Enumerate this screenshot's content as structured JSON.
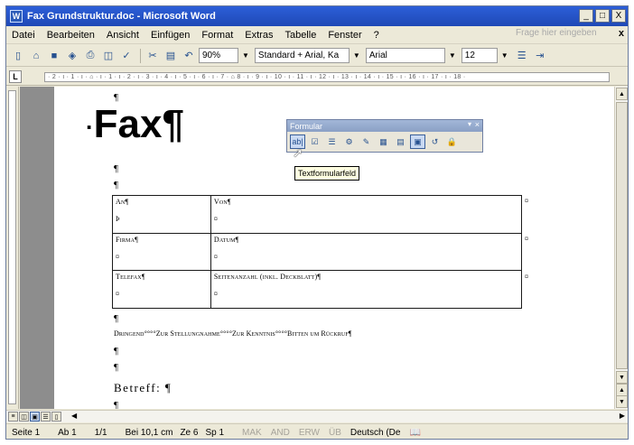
{
  "window": {
    "title": "Fax Grundstruktur.doc - Microsoft Word",
    "buttons": [
      "_",
      "□",
      "X"
    ],
    "app_icon": "W"
  },
  "menu": {
    "items": [
      "Datei",
      "Bearbeiten",
      "Ansicht",
      "Einfügen",
      "Format",
      "Extras",
      "Tabelle",
      "Fenster",
      "?"
    ],
    "help_placeholder": "Frage hier eingeben",
    "close_doc": "x"
  },
  "toolbar": {
    "zoom": "90%",
    "style": "Standard + Arial, Ka",
    "font": "Arial",
    "size": "12",
    "icons": [
      "new-doc-icon",
      "open-icon",
      "save-icon",
      "permission-icon",
      "print-icon",
      "preview-icon",
      "spelling-icon",
      "cut-icon",
      "paste-icon",
      "undo-icon"
    ]
  },
  "ruler": {
    "text": "· 2 · ı · 1 · ı · ⌂ · ı · 1 · ı · 2 · ı · 3 · ı · 4 · ı · 5 · ı · 6 · ı · 7 · ⌂ 8 · ı · 9 · ı · 10 · ı · 11 · ı · 12 · ı · 13 · ı · 14 · ı · 15 · ı · 16 · ı · 17 · ı · 18 ·"
  },
  "document": {
    "pilcrow": "¶",
    "title": "Fax¶",
    "title_bullet": "·",
    "table": {
      "rows": [
        [
          {
            "label": "An¶",
            "value": "Þ"
          },
          {
            "label": "Von¶",
            "value": "¤"
          }
        ],
        [
          {
            "label": "Firma¶",
            "value": "¤"
          },
          {
            "label": "Datum¶",
            "value": "¤"
          }
        ],
        [
          {
            "label": "Telefax¶",
            "value": "¤"
          },
          {
            "label": "Seitenanzahl (inkl. Deckblatt)¶",
            "value": "¤"
          }
        ]
      ],
      "row_end_mark": "¤"
    },
    "urgency_line": "Dringend°°°°Zur Stellungnahme°°°°Zur Kenntnis°°°°Bitten um Rückruf¶",
    "subject": "Betreff: ¶"
  },
  "form_toolbar": {
    "title": "Formular",
    "menu_glyph": "▾",
    "close_glyph": "×",
    "icons": [
      {
        "name": "text-formfield-icon",
        "glyph": "ab|",
        "pressed": true
      },
      {
        "name": "checkbox-formfield-icon",
        "glyph": "☑",
        "pressed": false
      },
      {
        "name": "dropdown-formfield-icon",
        "glyph": "☰",
        "pressed": false
      },
      {
        "name": "formfield-options-icon",
        "glyph": "⚙",
        "pressed": false
      },
      {
        "name": "draw-table-icon",
        "glyph": "✎",
        "pressed": false
      },
      {
        "name": "insert-table-icon",
        "glyph": "▦",
        "pressed": false
      },
      {
        "name": "insert-frame-icon",
        "glyph": "▤",
        "pressed": false
      },
      {
        "name": "formfield-shading-icon",
        "glyph": "▣",
        "pressed": true
      },
      {
        "name": "reset-formfields-icon",
        "glyph": "↺",
        "pressed": false
      },
      {
        "name": "protect-form-icon",
        "glyph": "🔒",
        "pressed": false
      }
    ],
    "tooltip": "Textformularfeld"
  },
  "statusbar": {
    "page": "Seite 1",
    "section": "Ab 1",
    "pages": "1/1",
    "position": "Bei 10,1 cm",
    "line": "Ze 6",
    "column": "Sp 1",
    "modes": [
      "MAK",
      "AND",
      "ERW",
      "ÜB"
    ],
    "language": "Deutsch (De"
  },
  "colors": {
    "title_bar": "#2c5fd8",
    "chrome": "#ece9d8",
    "tooltip_bg": "#ffffe1",
    "doc_background": "#8d8d8d"
  }
}
